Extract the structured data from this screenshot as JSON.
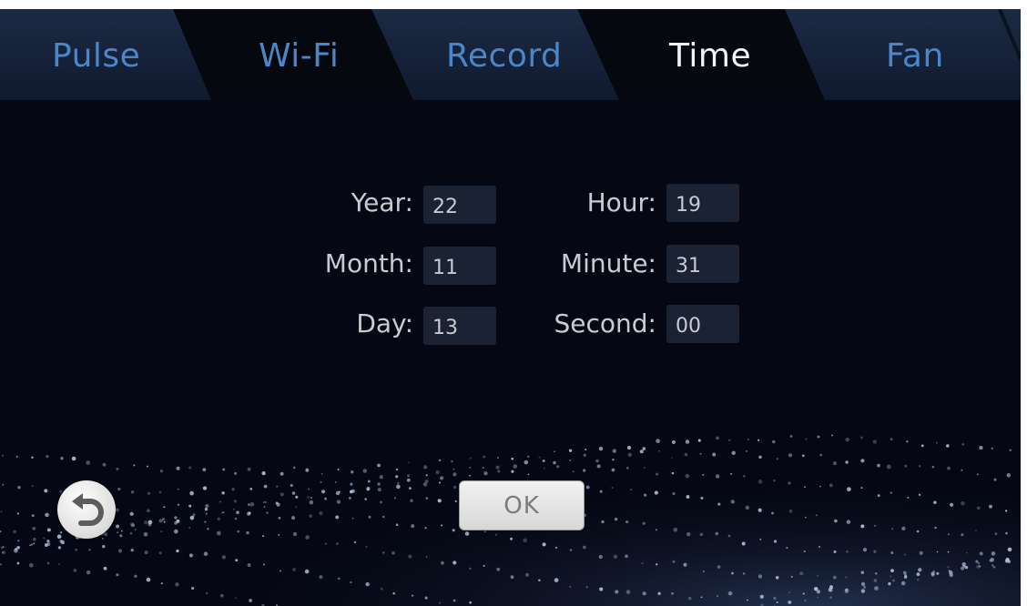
{
  "tabs": [
    {
      "label": "Pulse",
      "active": false
    },
    {
      "label": "Wi-Fi",
      "active": false
    },
    {
      "label": "Record",
      "active": false
    },
    {
      "label": "Time",
      "active": true
    },
    {
      "label": "Fan",
      "active": false
    }
  ],
  "time_form": {
    "year": {
      "label": "Year:",
      "value": "22"
    },
    "month": {
      "label": "Month:",
      "value": "11"
    },
    "day": {
      "label": "Day:",
      "value": "13"
    },
    "hour": {
      "label": "Hour:",
      "value": "19"
    },
    "minute": {
      "label": "Minute:",
      "value": "31"
    },
    "second": {
      "label": "Second:",
      "value": "00"
    }
  },
  "buttons": {
    "ok_label": "OK",
    "back_icon": "undo-arrow-icon"
  },
  "colors": {
    "background": "#050814",
    "tab_inactive_text": "#4a86c8",
    "tab_active_text": "#f3f4f6",
    "field_bg": "#1b2233"
  }
}
